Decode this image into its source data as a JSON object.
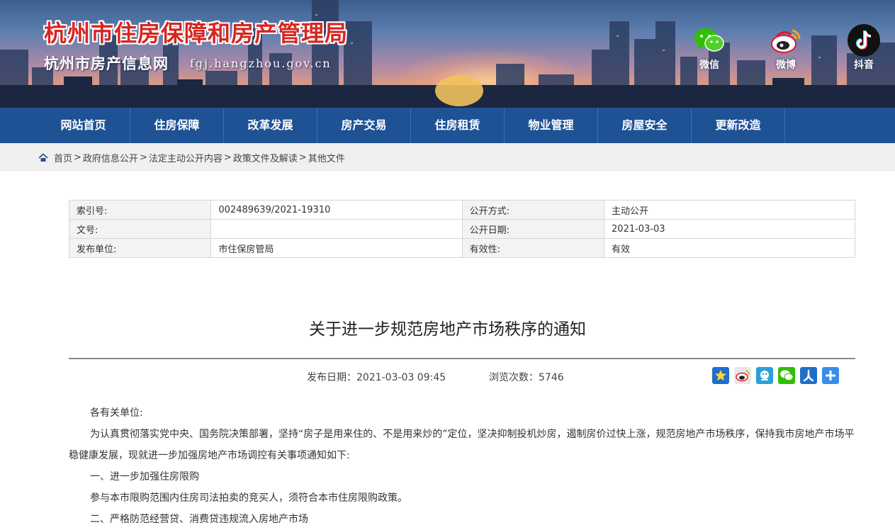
{
  "header": {
    "title": "杭州市住房保障和房产管理局",
    "subtitle": "杭州市房产信息网",
    "domain": "fgj.hangzhou.gov.cn",
    "social": [
      {
        "label": "微信",
        "icon": "wechat-icon",
        "color": "#2dc100"
      },
      {
        "label": "微博",
        "icon": "weibo-icon",
        "color": "#e6162d"
      },
      {
        "label": "抖音",
        "icon": "douyin-icon",
        "color": "#111111"
      }
    ]
  },
  "nav": {
    "items": [
      "网站首页",
      "住房保障",
      "改革发展",
      "房产交易",
      "住房租赁",
      "物业管理",
      "房屋安全",
      "更新改造"
    ],
    "color": "#1f5295"
  },
  "breadcrumb": {
    "icon": "home-icon",
    "items": [
      "首页",
      "政府信息公开",
      "法定主动公开内容",
      "政策文件及解读",
      "其他文件"
    ]
  },
  "info": {
    "rows": [
      {
        "k1": "索引号:",
        "v1": "002489639/2021-19310",
        "k2": "公开方式:",
        "v2": "主动公开"
      },
      {
        "k1": "文号:",
        "v1": "",
        "k2": "公开日期:",
        "v2": "2021-03-03"
      },
      {
        "k1": "发布单位:",
        "v1": "市住保房管局",
        "k2": "有效性:",
        "v2": "有效"
      }
    ]
  },
  "article": {
    "title": "关于进一步规范房地产市场秩序的通知",
    "publish_date": "发布日期：2021-03-03 09:45",
    "views": "浏览次数：5746",
    "share": [
      "star-icon",
      "weibo-share-icon",
      "qq-share-icon",
      "wechat-share-icon",
      "renren-share-icon",
      "plus-icon"
    ],
    "paragraphs": [
      "各有关单位:",
      "为认真贯彻落实党中央、国务院决策部署，坚持“房子是用来住的、不是用来炒的”定位，坚决抑制投机炒房，遏制房价过快上涨，规范房地产市场秩序，保持我市房地产市场平稳健康发展，现就进一步加强房地产市场调控有关事项通知如下:",
      "一、进一步加强住房限购",
      "参与本市限购范围内住房司法拍卖的竞买人，须符合本市住房限购政策。",
      "二、严格防范经营贷、消费贷违规流入房地产市场"
    ]
  }
}
